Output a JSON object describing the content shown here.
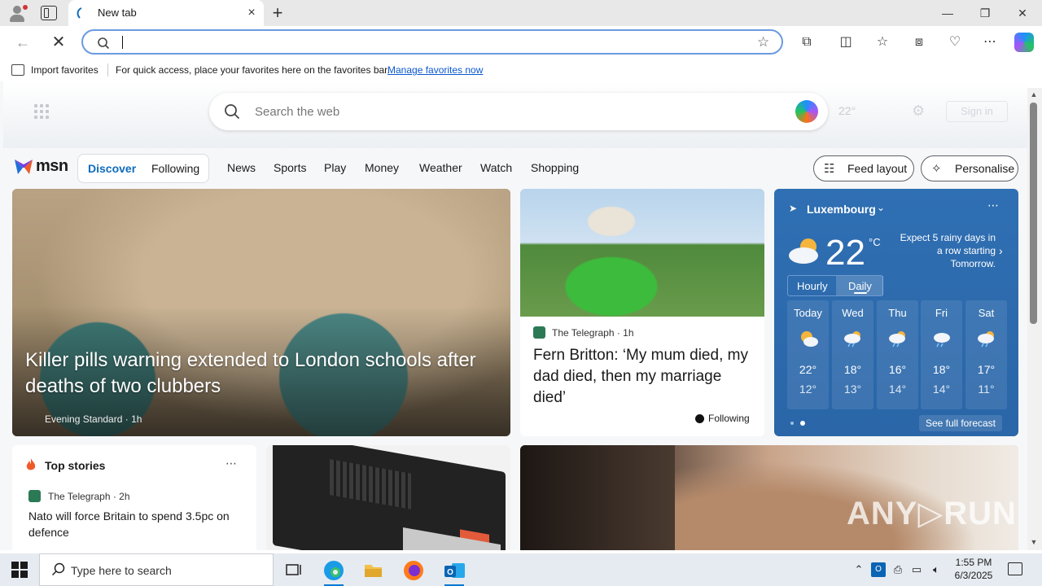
{
  "browser": {
    "tab_title": "New tab",
    "new_tab_symbol": "+",
    "close_symbol": "×",
    "address_value": "",
    "window": {
      "minimize": "—",
      "restore": "❐",
      "close": "✕"
    }
  },
  "favorites_bar": {
    "import_label": "Import favorites",
    "hint": "For quick access, place your favorites here on the favorites bar.",
    "manage_link": "Manage favorites now"
  },
  "msn": {
    "search_placeholder": "Search the web",
    "faded_weather": "22°",
    "faded_signin": "Sign in",
    "logo_text": "msn",
    "pill_tabs": [
      "Discover",
      "Following"
    ],
    "nav_links": [
      "News",
      "Sports",
      "Play",
      "Money",
      "Weather",
      "Watch",
      "Shopping"
    ],
    "feed_layout": "Feed layout",
    "personalise": "Personalise",
    "hero": {
      "source": "Evening Standard",
      "age": "1h",
      "headline": "Killer pills warning extended to London schools after deaths of two clubbers"
    },
    "story2": {
      "publisher": "The Telegraph",
      "age": "1h",
      "headline": "Fern Britton: ‘My mum died, my dad died, then my marriage died’",
      "following": "Following"
    },
    "weather": {
      "location": "Luxembourg",
      "temp": "22",
      "unit": "°C",
      "alert": "Expect 5 rainy days in a row starting Tomorrow.",
      "toggle": [
        "Hourly",
        "Daily"
      ],
      "days": [
        {
          "name": "Today",
          "hi": "22°",
          "lo": "12°"
        },
        {
          "name": "Wed",
          "hi": "18°",
          "lo": "13°"
        },
        {
          "name": "Thu",
          "hi": "16°",
          "lo": "14°"
        },
        {
          "name": "Fri",
          "hi": "18°",
          "lo": "14°"
        },
        {
          "name": "Sat",
          "hi": "17°",
          "lo": "11°"
        }
      ],
      "see_full": "See full forecast"
    },
    "top_stories": {
      "title": "Top stories",
      "publisher": "The Telegraph",
      "age": "2h",
      "headline": "Nato will force Britain to spend 3.5pc on defence"
    },
    "watermark": "ANY▷RUN"
  },
  "taskbar": {
    "search_placeholder": "Type here to search",
    "time": "1:55 PM",
    "date": "6/3/2025"
  },
  "colors": {
    "accent": "#0078d4",
    "weather_card": "#2f6fb3",
    "link": "#0b57d0"
  }
}
